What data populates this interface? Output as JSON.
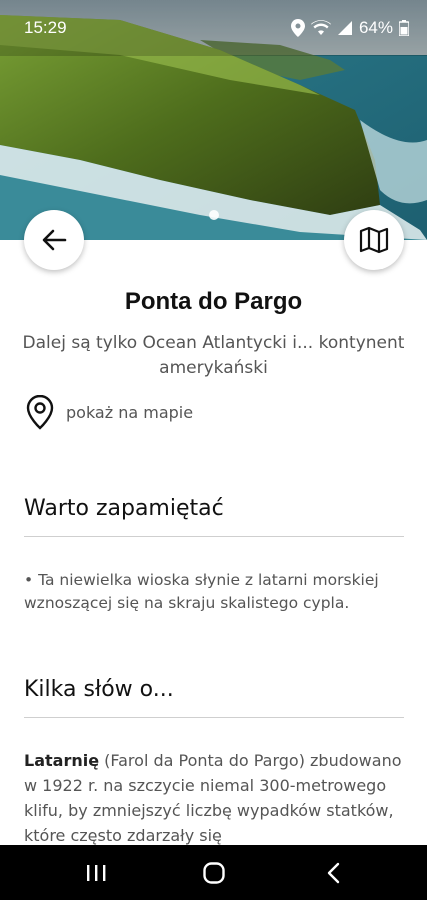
{
  "status_bar": {
    "time": "15:29",
    "battery": "64%",
    "icons": [
      "location-icon",
      "wifi-icon",
      "signal-icon",
      "battery-icon"
    ]
  },
  "hero": {
    "image_description": "aerial-cliff-photo",
    "active_page": 1,
    "page_count": 1
  },
  "place": {
    "title": "Ponta do Pargo",
    "subtitle": "Dalej są tylko Ocean Atlantycki i... kontynent amerykański",
    "map_link": "pokaż na mapie"
  },
  "sections": [
    {
      "heading": "Warto zapamiętać",
      "bullet": "• Ta niewielka wioska słynie z latarni morskiej wznoszącej się na skraju skalistego cypla."
    },
    {
      "heading": "Kilka słów o...",
      "paragraph_bold": "Latarnię",
      "paragraph_rest": " (Farol da Ponta do Pargo) zbudowano w 1922 r. na szczycie niemal 300-metrowego klifu, by zmniejszyć liczbę wypadków statków, które często zdarzały się"
    }
  ],
  "colors": {
    "accent": "#111111",
    "muted_text": "#555555",
    "divider": "#cfcfcf",
    "navbar": "#000000"
  }
}
